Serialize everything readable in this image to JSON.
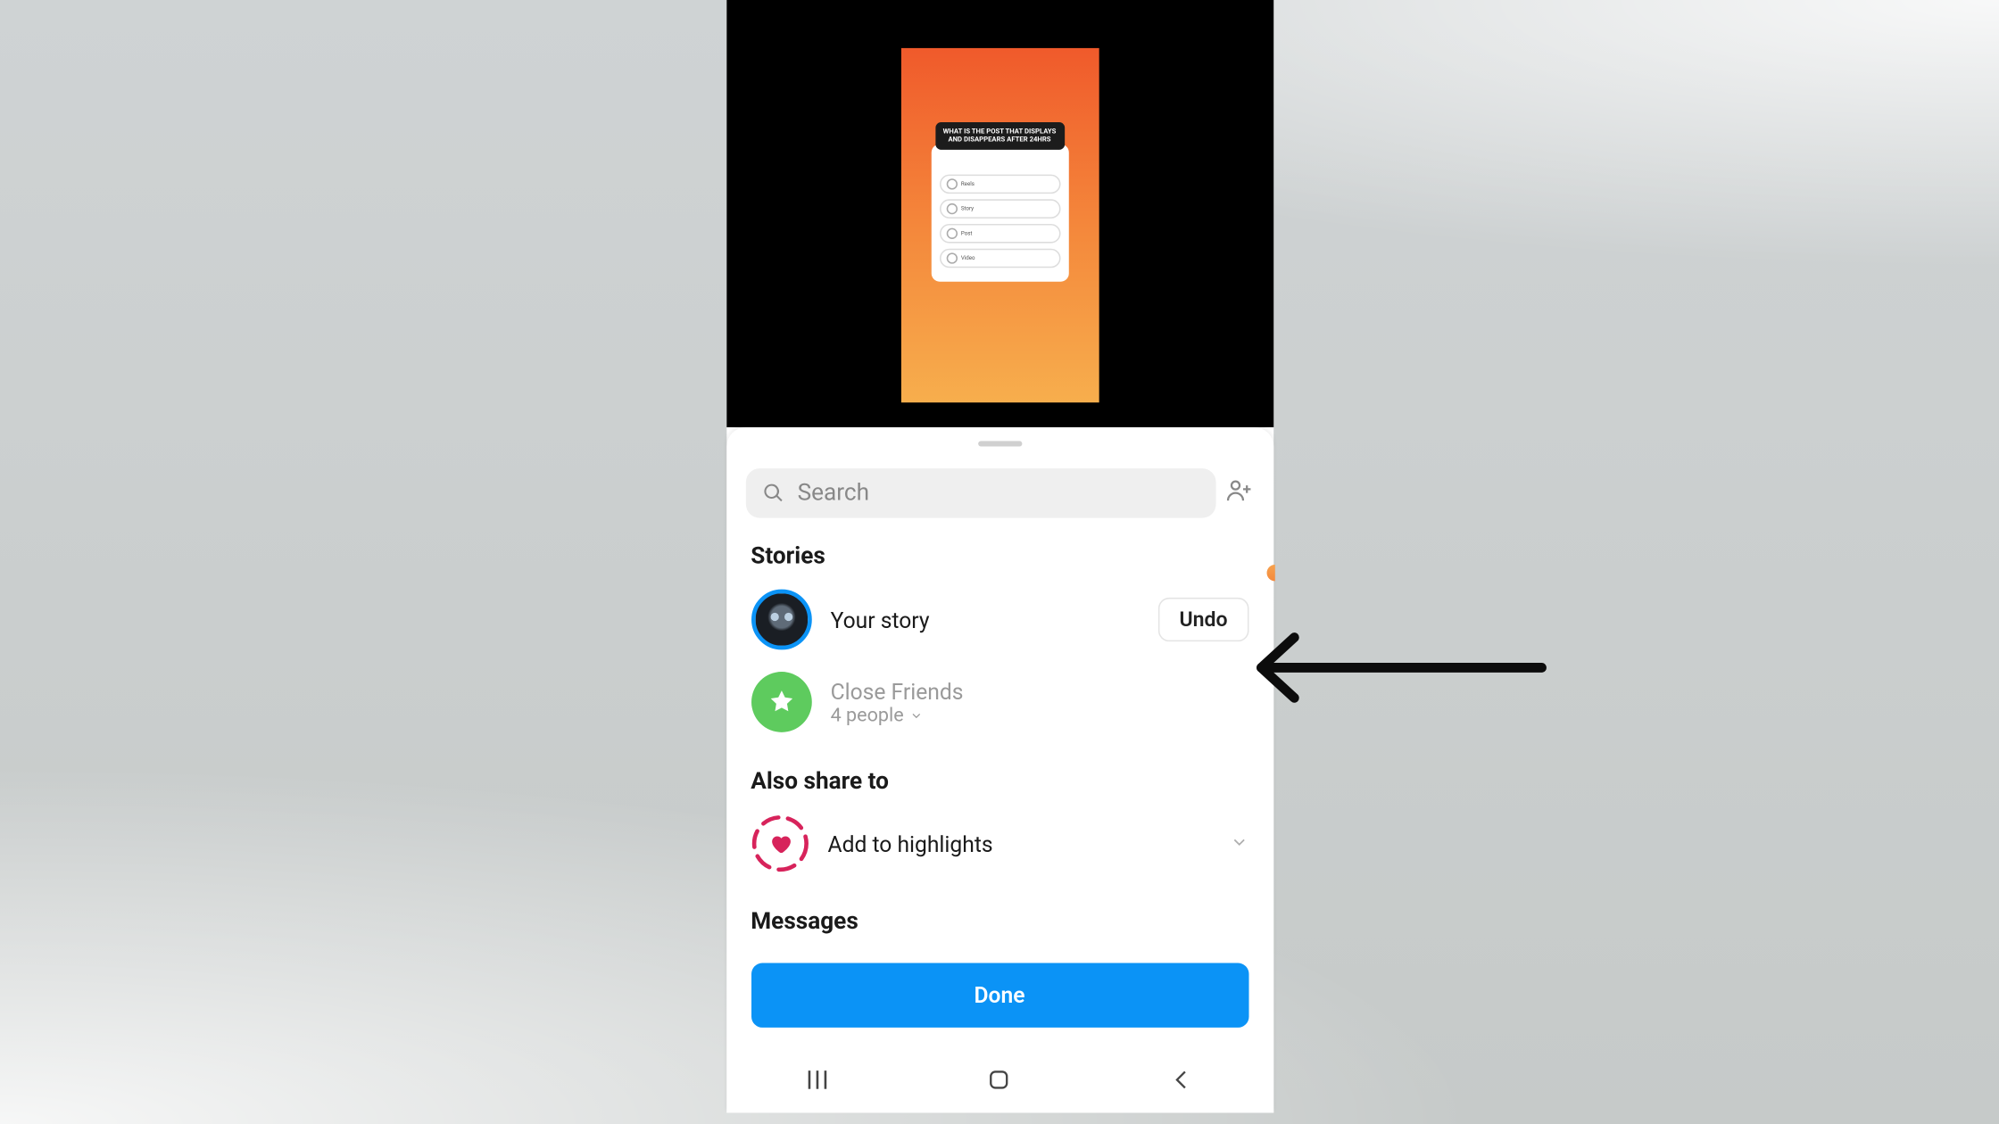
{
  "preview": {
    "quiz_title_line1": "WHAT IS THE POST THAT DISPLAYS",
    "quiz_title_line2": "AND DISAPPEARS AFTER 24HRS",
    "options": [
      "Reels",
      "Story",
      "Post",
      "Video"
    ]
  },
  "search": {
    "placeholder": "Search"
  },
  "sections": {
    "stories": "Stories",
    "also_share": "Also share to",
    "messages": "Messages"
  },
  "story_row": {
    "label": "Your story",
    "button": "Undo"
  },
  "close_friends": {
    "label": "Close Friends",
    "sub": "4 people"
  },
  "highlights": {
    "label": "Add to highlights"
  },
  "done": "Done"
}
